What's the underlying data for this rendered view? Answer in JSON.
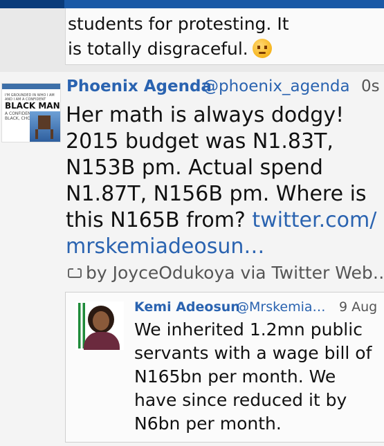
{
  "previous_tweet": {
    "lines": [
      "students for protesting. It",
      "is totally disgraceful."
    ],
    "emoji": "angry-face-icon"
  },
  "tweet": {
    "author_name": "Phoenix Agenda",
    "author_handle": "@phoenix_agenda",
    "timestamp": "0s",
    "avatar": {
      "line1": "I'M GROUNDED IN WHO I AM",
      "line1b": "AND I AM A CONFIDENT",
      "line2": "BLACK MAN",
      "line3": "A CONFIDENT",
      "line3b": "BLACK, CHOC"
    },
    "lines": [
      "Her math is always dodgy!",
      "2015 budget was N1.83T,",
      "N153B pm. Actual spend",
      "N1.87T, N156B pm. Where is"
    ],
    "line5_text": "this N165B from?",
    "line5_link": "twitter.com/",
    "line6_link": "mrskemiadeosun…",
    "retweet_text": "by JoyceOdukoya via Twitter Web…"
  },
  "quoted_tweet": {
    "author_name": "Kemi Adeosun",
    "author_handle": "@Mrskemia…",
    "timestamp": "9 Aug",
    "lines": [
      "We inherited 1.2mn public",
      "servants with a wage bill of",
      "N165bn per month. We",
      "have since reduced it by",
      "N6bn per month."
    ]
  },
  "colors": {
    "link": "#2a63b0",
    "topbar": "#1a5aa6"
  }
}
